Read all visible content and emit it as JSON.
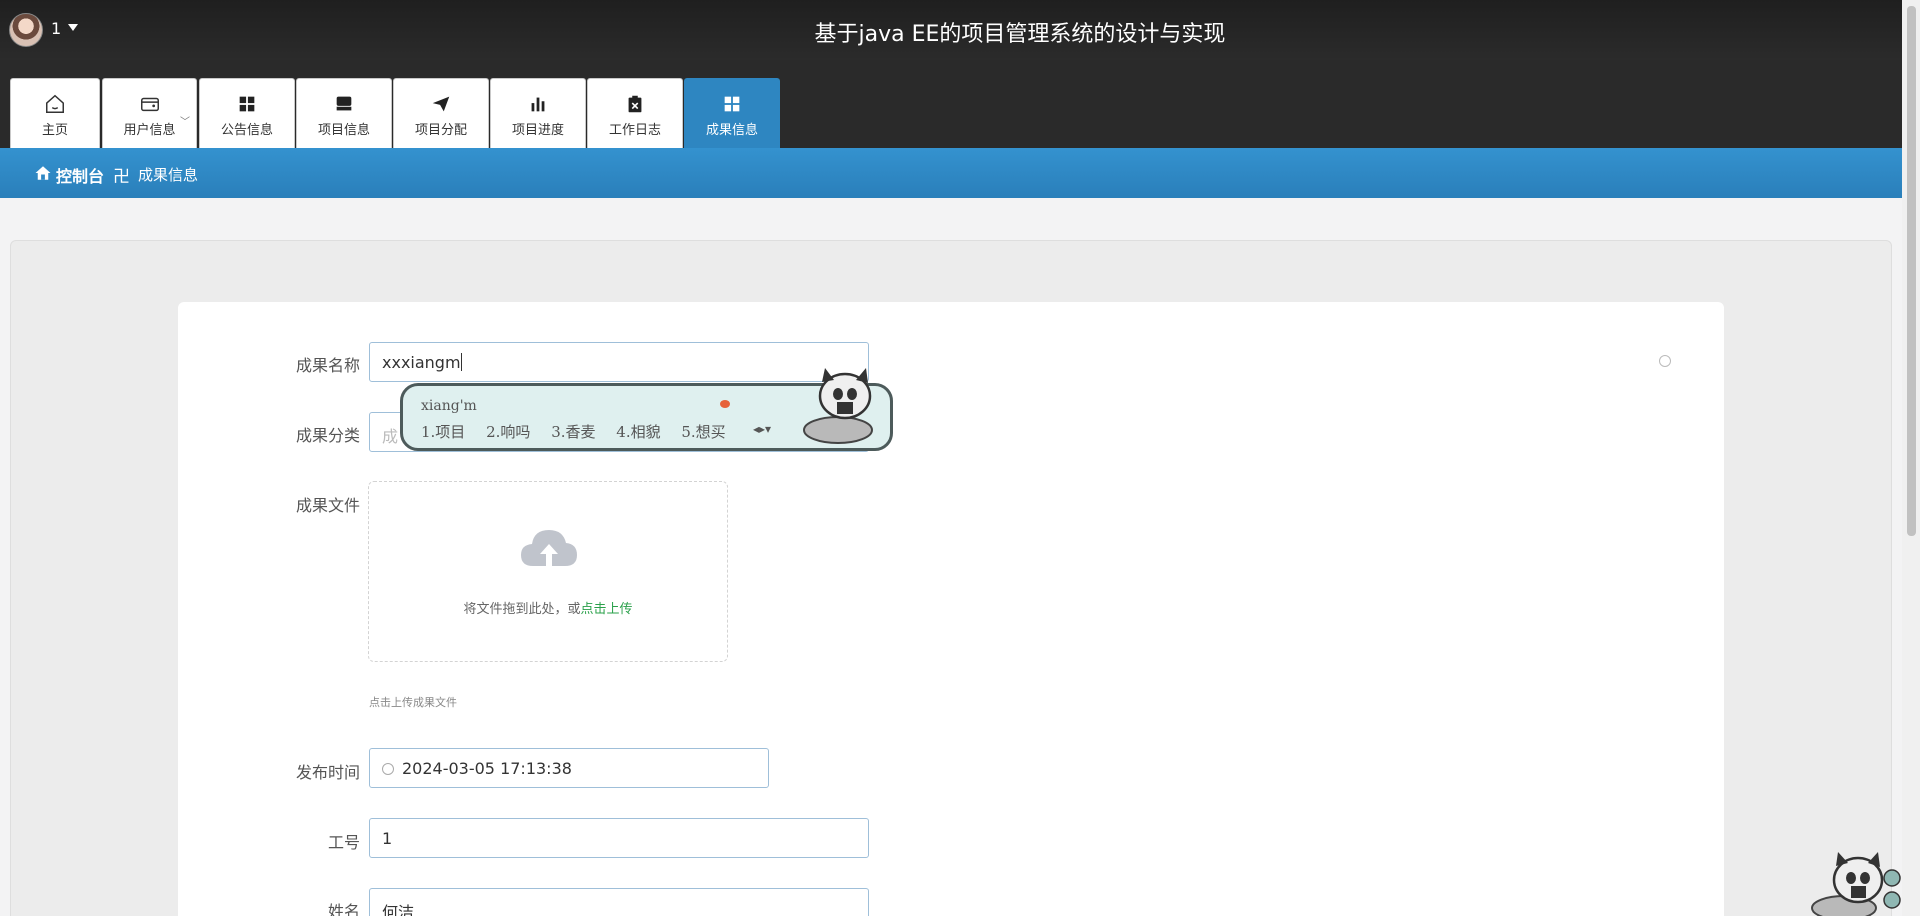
{
  "header": {
    "username": "1",
    "title": "基于java EE的项目管理系统的设计与实现"
  },
  "nav": {
    "tabs": [
      {
        "label": "主页",
        "icon": "home-icon"
      },
      {
        "label": "用户信息",
        "icon": "wallet-icon"
      },
      {
        "label": "公告信息",
        "icon": "grid-icon"
      },
      {
        "label": "项目信息",
        "icon": "store-icon"
      },
      {
        "label": "项目分配",
        "icon": "send-icon"
      },
      {
        "label": "项目进度",
        "icon": "bar-chart-icon"
      },
      {
        "label": "工作日志",
        "icon": "clipboard-x-icon"
      },
      {
        "label": "成果信息",
        "icon": "grid-icon"
      }
    ],
    "active": "成果信息",
    "accent": "#2e86c1"
  },
  "breadcrumb": {
    "root": "控制台",
    "separator": "卍",
    "current": "成果信息"
  },
  "form": {
    "name_label": "成果名称",
    "name_value": "xxxiangm",
    "category_label": "成果分类",
    "category_placeholder": "成",
    "file_label": "成果文件",
    "upload_text": "将文件拖到此处，或",
    "upload_link": "点击上传",
    "upload_hint": "点击上传成果文件",
    "time_label": "发布时间",
    "time_value": "2024-03-05 17:13:38",
    "id_label": "工号",
    "id_value": "1",
    "person_label": "姓名",
    "person_value": "何洁"
  },
  "ime": {
    "composition": "xiang'm",
    "candidates": [
      "1.项目",
      "2.响吗",
      "3.香麦",
      "4.相貌",
      "5.想买"
    ]
  }
}
